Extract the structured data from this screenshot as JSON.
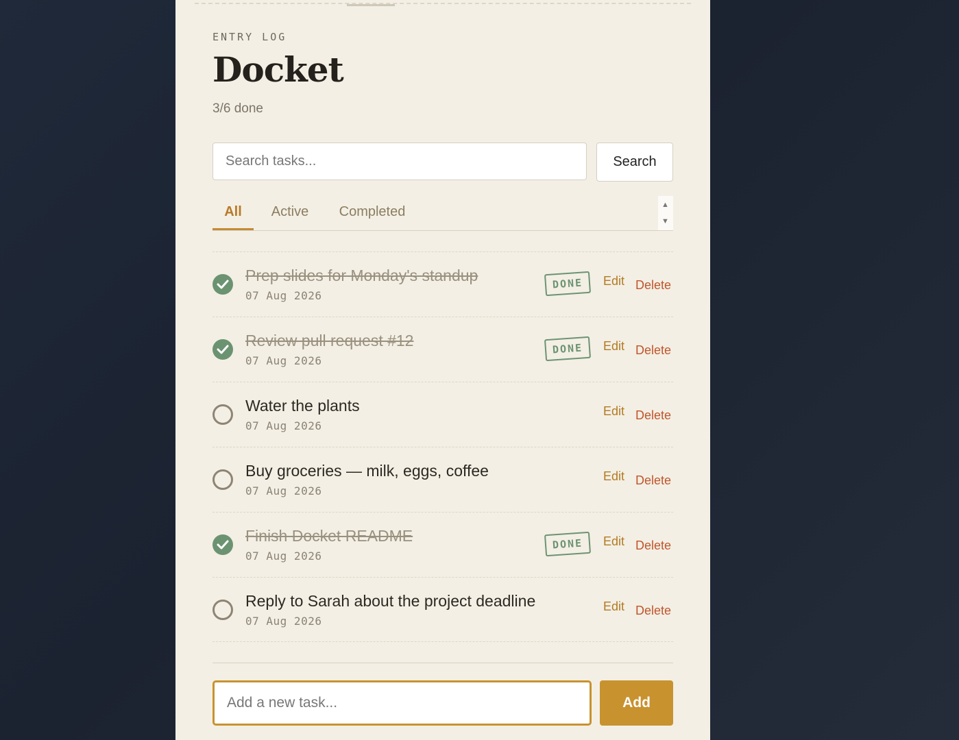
{
  "header": {
    "eyebrow": "ENTRY LOG",
    "title": "Docket",
    "progress_text": "3/6 done"
  },
  "search": {
    "placeholder": "Search tasks...",
    "button_label": "Search"
  },
  "tabs": [
    {
      "label": "All",
      "active": true
    },
    {
      "label": "Active",
      "active": false
    },
    {
      "label": "Completed",
      "active": false
    }
  ],
  "tasks": [
    {
      "text": "Prep slides for Monday's standup",
      "date": "07 Aug 2026",
      "done": true,
      "stamp": "DONE",
      "edit_label": "Edit",
      "delete_label": "Delete"
    },
    {
      "text": "Review pull request #12",
      "date": "07 Aug 2026",
      "done": true,
      "stamp": "DONE",
      "edit_label": "Edit",
      "delete_label": "Delete"
    },
    {
      "text": "Water the plants",
      "date": "07 Aug 2026",
      "done": false,
      "stamp": "",
      "edit_label": "Edit",
      "delete_label": "Delete"
    },
    {
      "text": "Buy groceries — milk, eggs, coffee",
      "date": "07 Aug 2026",
      "done": false,
      "stamp": "",
      "edit_label": "Edit",
      "delete_label": "Delete"
    },
    {
      "text": "Finish Docket README",
      "date": "07 Aug 2026",
      "done": true,
      "stamp": "DONE",
      "edit_label": "Edit",
      "delete_label": "Delete"
    },
    {
      "text": "Reply to Sarah about the project deadline",
      "date": "07 Aug 2026",
      "done": false,
      "stamp": "",
      "edit_label": "Edit",
      "delete_label": "Delete"
    }
  ],
  "add_task": {
    "placeholder": "Add a new task...",
    "button_label": "Add"
  },
  "colors": {
    "accent": "#c8922f",
    "done_green": "#6c9371",
    "delete_red": "#c0552c",
    "card_bg": "#f3efe4"
  },
  "icons": {
    "check": "checkmark-icon",
    "scroll_up": "scroll-up-icon",
    "scroll_down": "scroll-down-icon"
  }
}
